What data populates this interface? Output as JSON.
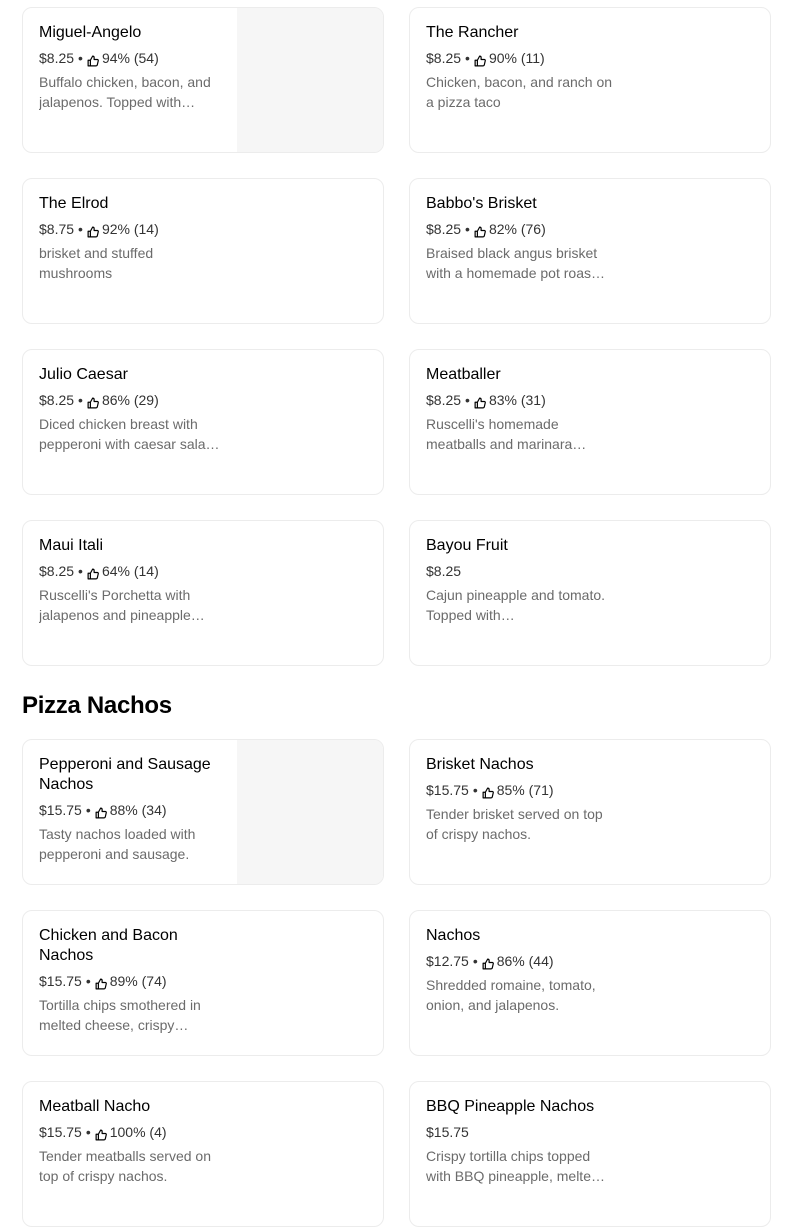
{
  "sections": [
    {
      "items": [
        {
          "name": "Miguel-Angelo",
          "price": "$8.25",
          "rating": "94% (54)",
          "desc": "Buffalo chicken, bacon, and jalapenos. Topped with…",
          "has_image": true
        },
        {
          "name": "The Rancher",
          "price": "$8.25",
          "rating": "90% (11)",
          "desc": "Chicken, bacon, and ranch on a pizza taco",
          "has_image": false
        },
        {
          "name": "The Elrod",
          "price": "$8.75",
          "rating": "92% (14)",
          "desc": "brisket and stuffed mushrooms",
          "has_image": false
        },
        {
          "name": "Babbo's Brisket",
          "price": "$8.25",
          "rating": "82% (76)",
          "desc": "Braised black angus brisket with a homemade pot roas…",
          "has_image": false
        },
        {
          "name": "Julio Caesar",
          "price": "$8.25",
          "rating": "86% (29)",
          "desc": "Diced chicken breast with pepperoni with caesar sala…",
          "has_image": false
        },
        {
          "name": "Meatballer",
          "price": "$8.25",
          "rating": "83% (31)",
          "desc": "Ruscelli's homemade meatballs and marinara…",
          "has_image": false
        },
        {
          "name": "Maui Itali",
          "price": "$8.25",
          "rating": "64% (14)",
          "desc": "Ruscelli's Porchetta with jalapenos and pineapple…",
          "has_image": false
        },
        {
          "name": "Bayou Fruit",
          "price": "$8.25",
          "rating": null,
          "desc": "Cajun pineapple and tomato. Topped with…",
          "has_image": false
        }
      ]
    },
    {
      "title": "Pizza Nachos",
      "items": [
        {
          "name": "Pepperoni and Sausage Nachos",
          "price": "$15.75",
          "rating": "88% (34)",
          "desc": "Tasty nachos loaded with pepperoni and sausage.",
          "has_image": true
        },
        {
          "name": "Brisket Nachos",
          "price": "$15.75",
          "rating": "85% (71)",
          "desc": "Tender brisket served on top of crispy nachos.",
          "has_image": false
        },
        {
          "name": "Chicken and Bacon Nachos",
          "price": "$15.75",
          "rating": "89% (74)",
          "desc": "Tortilla chips smothered in melted cheese, crispy…",
          "has_image": false
        },
        {
          "name": "Nachos",
          "price": "$12.75",
          "rating": "86% (44)",
          "desc": "Shredded romaine, tomato, onion, and jalapenos.",
          "has_image": false
        },
        {
          "name": "Meatball Nacho",
          "price": "$15.75",
          "rating": "100% (4)",
          "desc": "Tender meatballs served on top of crispy nachos.",
          "has_image": false
        },
        {
          "name": "BBQ Pineapple Nachos",
          "price": "$15.75",
          "rating": null,
          "desc": "Crispy tortilla chips topped with BBQ pineapple, melte…",
          "has_image": false
        }
      ]
    }
  ],
  "icons": {
    "rating": "thumbs-up-icon"
  },
  "separator": "•",
  "colors": {
    "text": "#000000",
    "muted": "#6b6b6b",
    "card_border": "#ececec",
    "image_placeholder": "#f6f6f6"
  }
}
